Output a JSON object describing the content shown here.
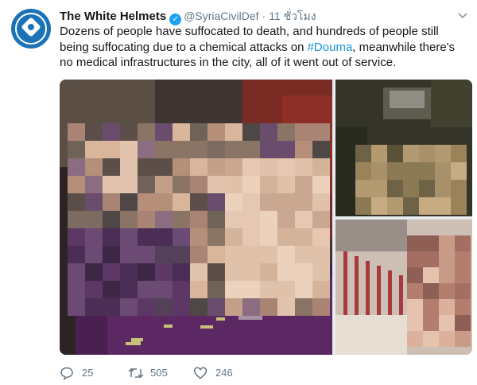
{
  "tweet": {
    "author_name": "The White Helmets",
    "author_handle": "@SyriaCivilDef",
    "separator": "·",
    "time": "11 ชั่วโมง",
    "text_before": "Dozens of people have suffocated to death, and hundreds of people still being suffocating due to a chemical attacks on ",
    "hashtag": "#Douma",
    "text_after": ", meanwhile there's no medical infrastructures in the city, all of it went out of service.",
    "media_count": 3
  },
  "actions": {
    "replies": "25",
    "retweets": "505",
    "likes": "246"
  },
  "colors": {
    "link": "#1b95e0",
    "verified": "#1da1f2",
    "secondary_text": "#657786",
    "avatar_bg": "#1a73b8"
  },
  "icons": [
    "verified-badge-icon",
    "caret-down-icon",
    "reply-icon",
    "retweet-icon",
    "like-icon"
  ]
}
